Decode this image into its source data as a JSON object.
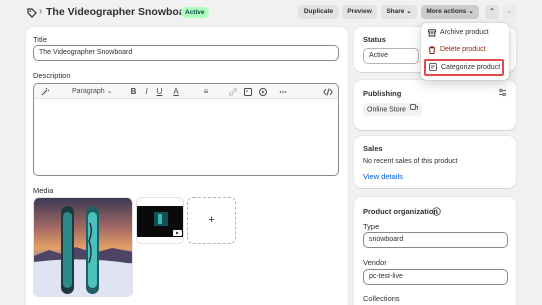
{
  "header": {
    "title": "The Videographer Snowboard",
    "status_badge": "Active",
    "buttons": {
      "duplicate": "Duplicate",
      "preview": "Preview",
      "share": "Share ⌄",
      "more_actions": "More actions ⌄",
      "prev": "⌃",
      "next": "⌄"
    }
  },
  "main": {
    "title_label": "Title",
    "title_value": "The Videographer Snowboard",
    "description_label": "Description",
    "toolbar": {
      "paragraph": "Paragraph ⌄",
      "bold": "B",
      "italic": "I",
      "underline": "U",
      "color": "A",
      "align": "≡"
    },
    "media_label": "Media",
    "media_add": "+"
  },
  "dropdown": {
    "archive": "Archive product",
    "delete": "Delete product",
    "categorize": "Categorize product"
  },
  "status_card": {
    "label": "Status",
    "value": "Active"
  },
  "publishing_card": {
    "label": "Publishing",
    "channel": "Online Store"
  },
  "sales_card": {
    "label": "Sales",
    "text": "No recent sales of this product",
    "link": "View details"
  },
  "organization_card": {
    "label": "Product organization",
    "type_label": "Type",
    "type_value": "snowboard",
    "vendor_label": "Vendor",
    "vendor_value": "pc-test-live",
    "collections_label": "Collections"
  },
  "colors": {
    "accent_blue": "#005bd3",
    "badge_green": "#affebf",
    "delete_red": "#8e1f0b",
    "highlight_red": "#e24a4a"
  }
}
